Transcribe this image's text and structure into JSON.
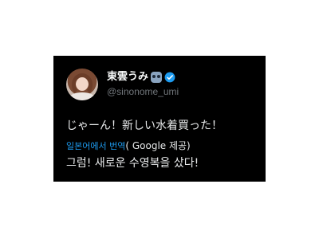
{
  "tweet": {
    "author": {
      "display_name": "東雲うみ",
      "handle": "@sinonome_umi",
      "badge_icon": "emoji-badge-icon",
      "verified_icon": "verified-badge-icon",
      "verified_color": "#1d9bf0"
    },
    "text": "じゃーん！新しい水着買った！",
    "translation": {
      "link_label": "일본어에서 번역",
      "provider_label": "( Google 제공)",
      "translated_text": "그럼! 새로운 수영복을 샀다!"
    }
  },
  "colors": {
    "card_background": "#000000",
    "primary_text": "#e7e9ea",
    "secondary_text": "#71767b",
    "link": "#1d9bf0"
  }
}
